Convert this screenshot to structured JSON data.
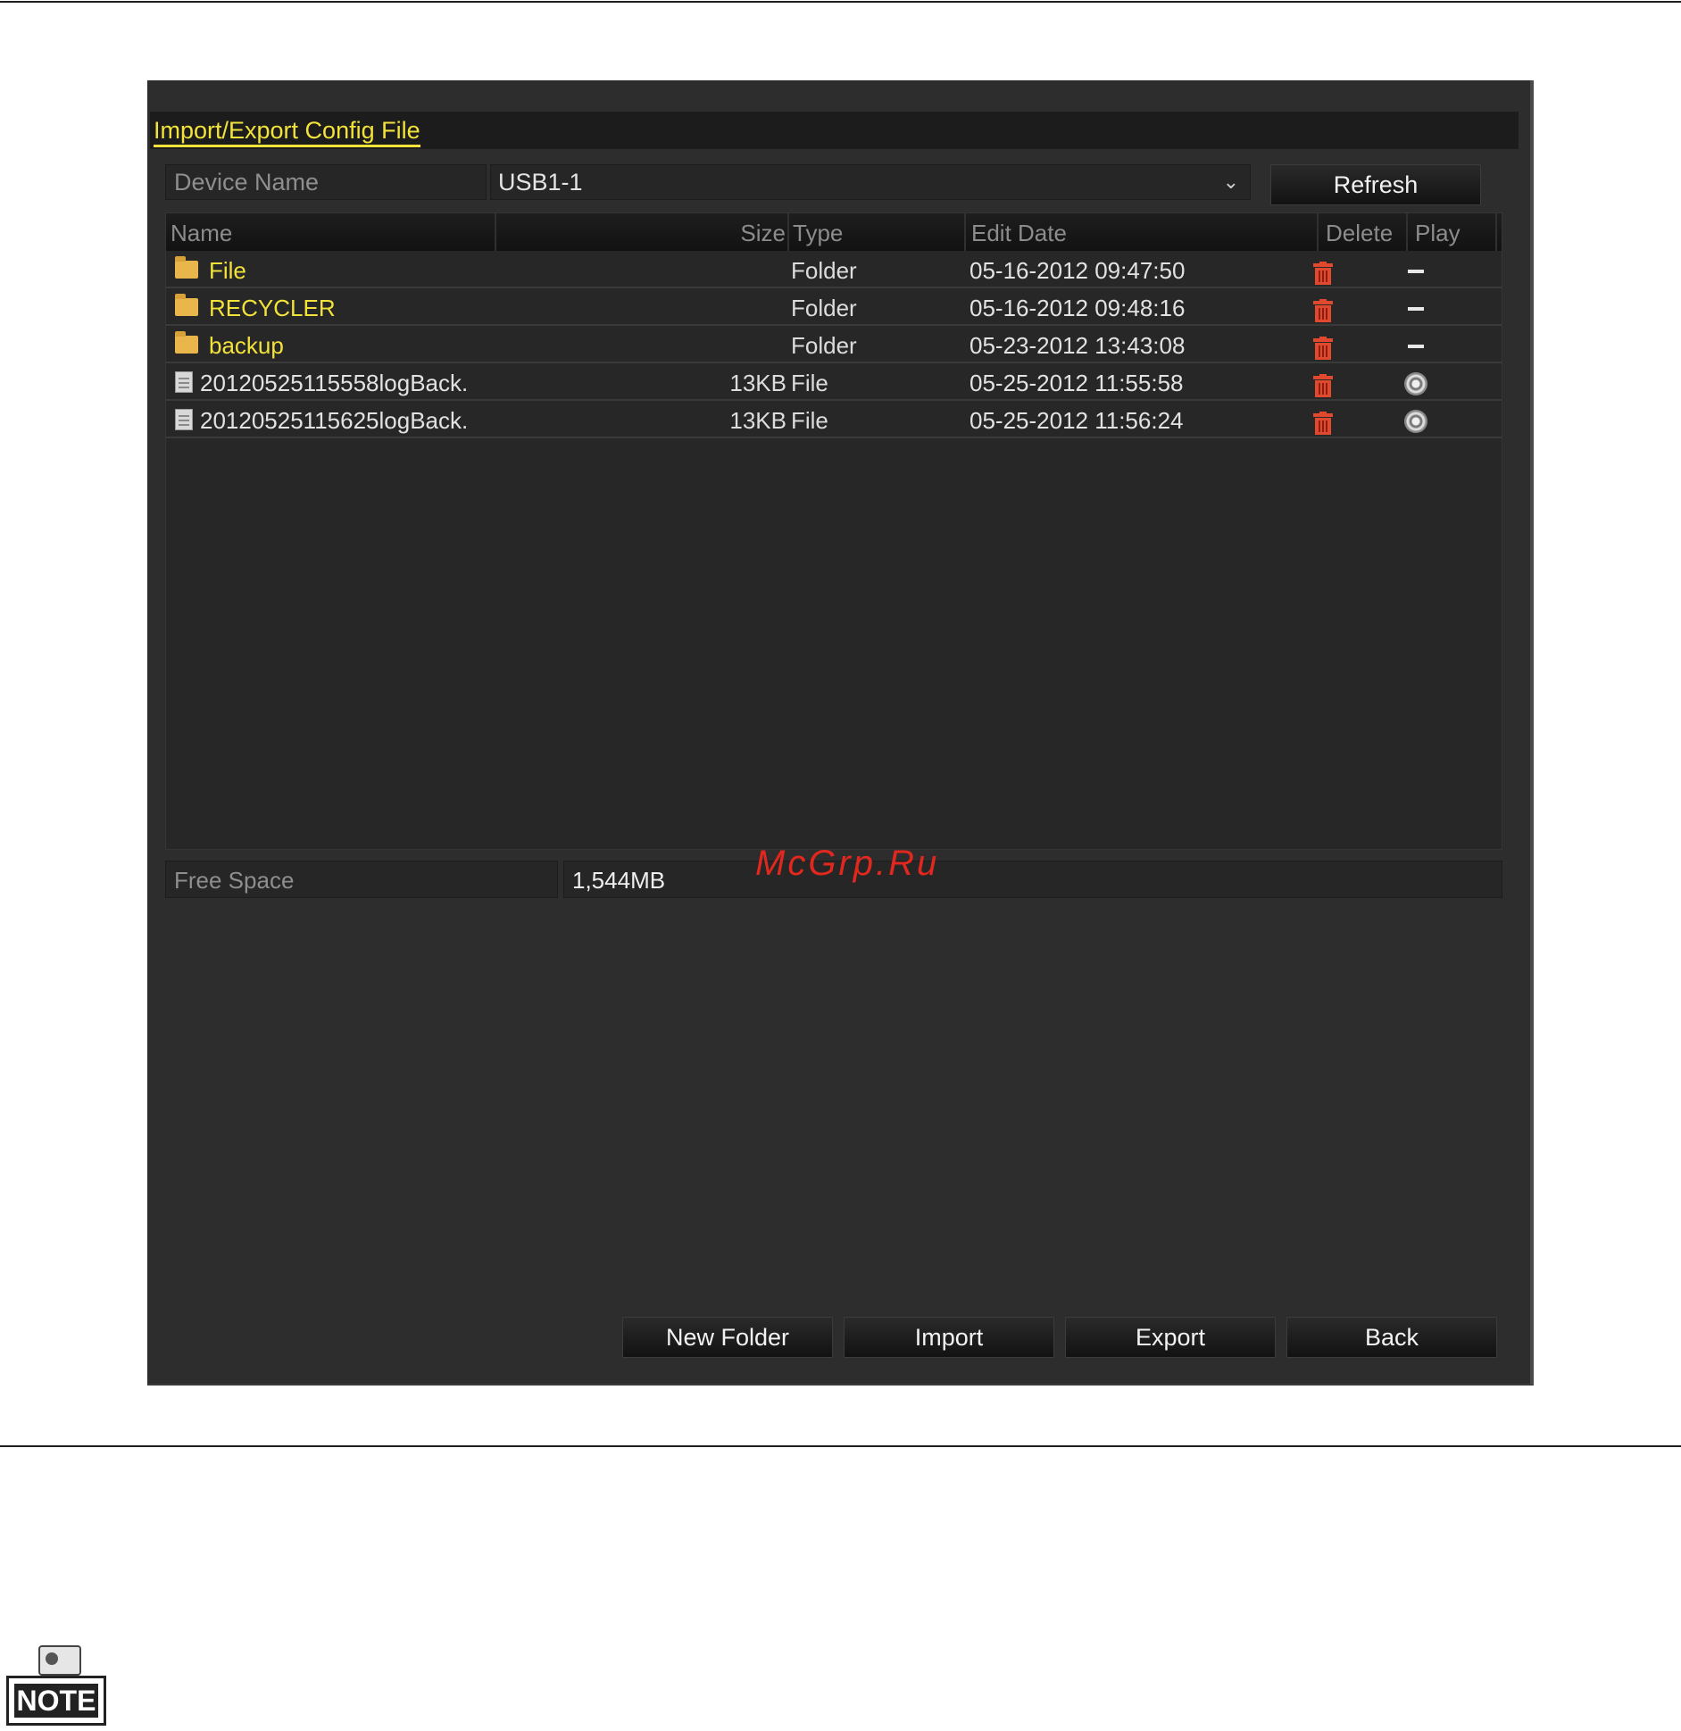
{
  "window": {
    "title": "Import/Export Config File"
  },
  "device": {
    "label": "Device Name",
    "selected": "USB1-1",
    "refresh_label": "Refresh"
  },
  "table": {
    "headers": {
      "name": "Name",
      "size": "Size",
      "type": "Type",
      "edit_date": "Edit Date",
      "delete": "Delete",
      "play": "Play"
    },
    "rows": [
      {
        "name": "File",
        "size": "",
        "type": "Folder",
        "date": "05-16-2012 09:47:50",
        "kind": "folder"
      },
      {
        "name": "RECYCLER",
        "size": "",
        "type": "Folder",
        "date": "05-16-2012 09:48:16",
        "kind": "folder"
      },
      {
        "name": "backup",
        "size": "",
        "type": "Folder",
        "date": "05-23-2012 13:43:08",
        "kind": "folder"
      },
      {
        "name": "20120525115558logBack.",
        "size": "13KB",
        "type": "File",
        "date": "05-25-2012 11:55:58",
        "kind": "file"
      },
      {
        "name": "20120525115625logBack.",
        "size": "13KB",
        "type": "File",
        "date": "05-25-2012 11:56:24",
        "kind": "file"
      }
    ]
  },
  "free_space": {
    "label": "Free Space",
    "value": "1,544MB"
  },
  "buttons": {
    "new_folder": "New Folder",
    "import": "Import",
    "export": "Export",
    "back": "Back"
  },
  "watermark": "McGrp.Ru",
  "note": {
    "label": "NOTE"
  },
  "colors": {
    "window_bg": "#2d2d2d",
    "accent_yellow": "#f2e23a",
    "delete_red": "#e0492e"
  },
  "icons": {
    "folder": "folder-icon",
    "file": "file-icon",
    "delete": "trash-icon",
    "play_disabled": "dash-icon",
    "play": "play-icon"
  }
}
